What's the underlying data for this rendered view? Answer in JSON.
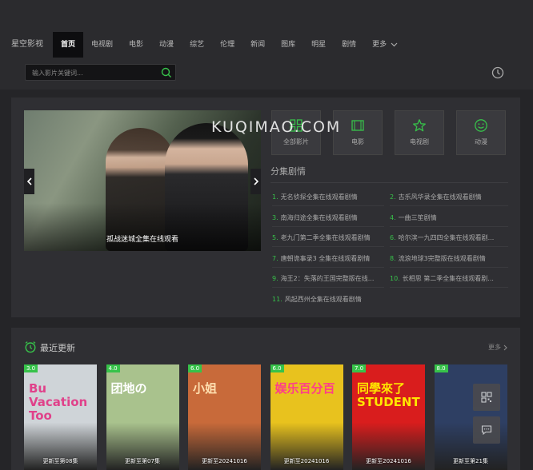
{
  "site": {
    "logo": "星空影视"
  },
  "nav": {
    "items": [
      "首页",
      "电视剧",
      "电影",
      "动漫",
      "综艺",
      "伦理",
      "新闻",
      "图库",
      "明星",
      "剧情"
    ],
    "more": "更多"
  },
  "search": {
    "placeholder": "输入影片关键词..."
  },
  "watermark": "KUQIMAO.COM",
  "slider": {
    "caption": "孤战迷城全集在线观看",
    "dots_total": 5,
    "dots_active_index": 3
  },
  "categories": [
    {
      "label": "全部影片",
      "icon": "grid-icon"
    },
    {
      "label": "电影",
      "icon": "film-icon"
    },
    {
      "label": "电视剧",
      "icon": "star-icon"
    },
    {
      "label": "动漫",
      "icon": "smile-icon"
    }
  ],
  "episodes": {
    "title": "分集剧情",
    "items": [
      {
        "num": "1.",
        "text": "无名侦探全集在线观看剧情"
      },
      {
        "num": "2.",
        "text": "古乐风华录全集在线观看剧情"
      },
      {
        "num": "3.",
        "text": "南海归途全集在线观看剧情"
      },
      {
        "num": "4.",
        "text": "一曲三笙剧情"
      },
      {
        "num": "5.",
        "text": "老九门第二季全集在线观看剧情"
      },
      {
        "num": "6.",
        "text": "哈尔滨一九四四全集在线观看剧..."
      },
      {
        "num": "7.",
        "text": "唐朝诡事录3 全集在线观看剧情"
      },
      {
        "num": "8.",
        "text": "流浪地球3完整版在线观看剧情"
      },
      {
        "num": "9.",
        "text": "海王2：失落的王国完整版在线..."
      },
      {
        "num": "10.",
        "text": "长相思 第二季全集在线观看剧..."
      },
      {
        "num": "11.",
        "text": "风起西州全集在线观看剧情"
      }
    ]
  },
  "recent": {
    "title": "最近更新",
    "more": "更多",
    "posters": [
      {
        "score": "3.0",
        "status": "更新至第08集",
        "art_text": "Bu Vacation Too",
        "bg": "#cfd4d8",
        "fg": "#e0418a"
      },
      {
        "score": "4.0",
        "status": "更新至第07集",
        "art_text": "团地の",
        "bg": "#a9c28d",
        "fg": "#ffffff"
      },
      {
        "score": "6.0",
        "status": "更新至20241016",
        "art_text": "小姐",
        "bg": "#c86a3a",
        "fg": "#ffe0b0"
      },
      {
        "score": "6.0",
        "status": "更新至20241016",
        "art_text": "娱乐百分百",
        "bg": "#e8c21e",
        "fg": "#ff3d8a"
      },
      {
        "score": "7.0",
        "status": "更新至20241016",
        "art_text": "同學來了 STUDENT",
        "bg": "#d91d1d",
        "fg": "#ffe600"
      },
      {
        "score": "8.0",
        "status": "更新至第21集",
        "art_text": "",
        "bg": "#2e3f63",
        "fg": "#9cc4ff"
      }
    ]
  },
  "colors": {
    "accent": "#37c24a",
    "background": "#252528",
    "panel": "#2f2f33"
  }
}
